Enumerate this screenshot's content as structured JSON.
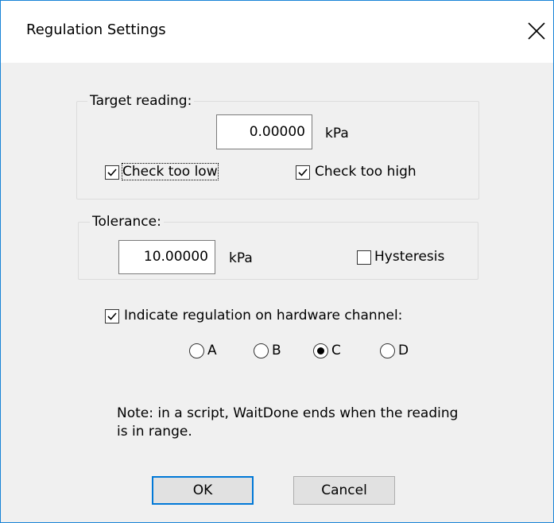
{
  "window": {
    "title": "Regulation Settings",
    "close_icon": "close-icon",
    "accent_color": "#0078d7"
  },
  "target_group": {
    "label": "Target reading:",
    "value": "0.00000",
    "unit": "kPa",
    "check_too_low": {
      "label": "Check too low",
      "checked": true
    },
    "check_too_high": {
      "label": "Check too high",
      "checked": true
    }
  },
  "tolerance_group": {
    "label": "Tolerance:",
    "value": "10.00000",
    "unit": "kPa",
    "hysteresis": {
      "label": "Hysteresis",
      "checked": false
    }
  },
  "indicate": {
    "label": "Indicate regulation on hardware channel:",
    "checked": true,
    "channels": [
      {
        "label": "A",
        "selected": false
      },
      {
        "label": "B",
        "selected": false
      },
      {
        "label": "C",
        "selected": true
      },
      {
        "label": "D",
        "selected": false
      }
    ]
  },
  "note": "Note: in a script, WaitDone ends when the reading is in range.",
  "buttons": {
    "ok_label": "OK",
    "cancel_label": "Cancel"
  }
}
